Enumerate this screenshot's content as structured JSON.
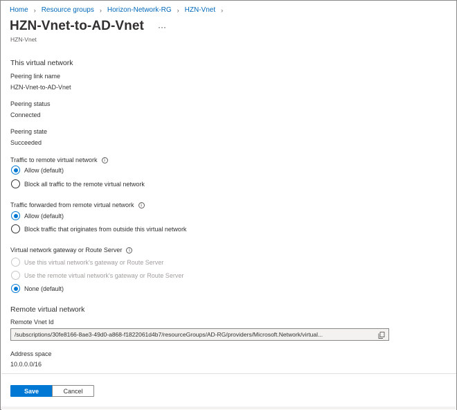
{
  "breadcrumb": [
    {
      "label": "Home"
    },
    {
      "label": "Resource groups"
    },
    {
      "label": "Horizon-Network-RG"
    },
    {
      "label": "HZN-Vnet"
    }
  ],
  "header": {
    "title": "HZN-Vnet-to-AD-Vnet",
    "more": "···",
    "subtitle": "HZN-Vnet"
  },
  "this_network": {
    "heading": "This virtual network",
    "peering_link_name_label": "Peering link name",
    "peering_link_name_value": "HZN-Vnet-to-AD-Vnet",
    "peering_status_label": "Peering status",
    "peering_status_value": "Connected",
    "peering_state_label": "Peering state",
    "peering_state_value": "Succeeded"
  },
  "traffic_to_remote": {
    "label": "Traffic to remote virtual network",
    "options": [
      "Allow (default)",
      "Block all traffic to the remote virtual network"
    ],
    "selected": "Allow (default)"
  },
  "traffic_forwarded": {
    "label": "Traffic forwarded from remote virtual network",
    "options": [
      "Allow (default)",
      "Block traffic that originates from outside this virtual network"
    ],
    "selected": "Allow (default)"
  },
  "gateway": {
    "label": "Virtual network gateway or Route Server",
    "options": [
      "Use this virtual network's gateway or Route Server",
      "Use the remote virtual network's gateway or Route Server",
      "None (default)"
    ],
    "selected": "None (default)"
  },
  "remote_network": {
    "heading": "Remote virtual network",
    "vnet_id_label": "Remote Vnet Id",
    "vnet_id_value": "/subscriptions/30fe8166-8ae3-49d0-a868-f1822061d4b7/resourceGroups/AD-RG/providers/Microsoft.Network/virtual...",
    "address_space_label": "Address space",
    "address_space_value": "10.0.0.0/16"
  },
  "footer": {
    "save_label": "Save",
    "cancel_label": "Cancel"
  },
  "icons": {
    "info": "i",
    "chevron": "›"
  },
  "colors": {
    "accent": "#0078d4",
    "link": "#0067b8"
  }
}
